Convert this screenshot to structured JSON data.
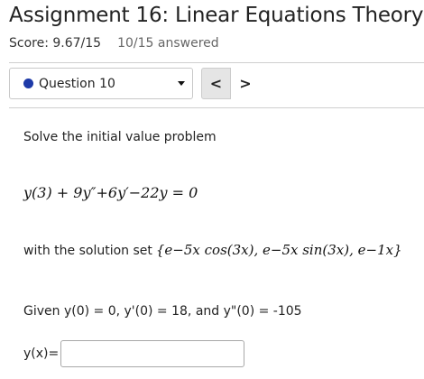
{
  "header": {
    "title": "Assignment 16: Linear Equations Theory",
    "score": "Score: 9.67/15",
    "answered": "10/15 answered"
  },
  "question_nav": {
    "selected_question": "Question 10",
    "status_color": "#1e3aa8",
    "prev_icon": "chevron-left-icon",
    "next_icon": "chevron-right-icon",
    "prev_glyph": "<",
    "next_glyph": ">"
  },
  "problem": {
    "prompt": "Solve the initial value problem",
    "equation": "y(3) + 9y″+6y′−22y = 0",
    "solution_prefix": "with the solution set",
    "solution_set": "{e−5x cos(3x), e−5x sin(3x), e−1x}",
    "conditions": "Given y(0) = 0, y'(0) = 18, and y\"(0) = -105"
  },
  "answer": {
    "label": "y(x)=",
    "value": "",
    "placeholder": ""
  }
}
